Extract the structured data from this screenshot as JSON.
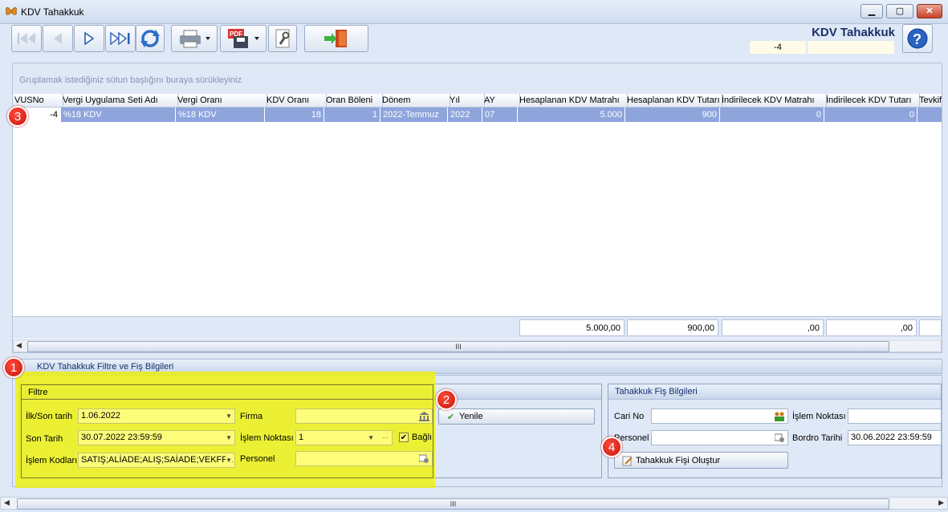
{
  "window": {
    "title": "KDV Tahakkuk",
    "min": "▁",
    "max": "▢",
    "close": "✕"
  },
  "header": {
    "title": "KDV Tahakkuk",
    "value": "-4",
    "value2": ""
  },
  "grid": {
    "group_prompt": "Gruplamak istediğiniz sütun başlığını buraya sürükleyiniz",
    "columns": [
      "VUSNo",
      "Vergi Uygulama Seti Adı",
      "Vergi Oranı",
      "KDV Oranı",
      "Oran Böleni",
      "Dönem",
      "Yıl",
      "AY",
      "Hesaplanan KDV Matrahı",
      "Hesaplanan KDV Tutarı",
      "İndirilecek KDV Matrahı",
      "İndirilecek KDV Tutarı",
      "Tevkif"
    ],
    "row": [
      "-4",
      "%18 KDV",
      "%18 KDV",
      "18",
      "1",
      "2022-Temmuz",
      "2022",
      "07",
      "5.000",
      "900",
      "0",
      "0",
      ""
    ],
    "totals": [
      "5.000,00",
      "900,00",
      ",00",
      ",00"
    ],
    "scroll_thumb": "III"
  },
  "section": {
    "title": "KDV Tahakkuk Filtre ve Fiş Bilgileri"
  },
  "filter": {
    "title": "Filtre",
    "ilk_son_label": "İlk/Son tarih",
    "ilk_son_value": "1.06.2022",
    "son_tarih_label": "Son Tarih",
    "son_tarih_value": "30.07.2022 23:59:59",
    "islem_kodlari_label": "İşlem Kodları",
    "islem_kodlari_value": "SATIŞ;ALİADE;ALIŞ;SAİADE;VEKFFA",
    "firma_label": "Firma",
    "firma_value": "",
    "islem_noktasi_label": "İşlem Noktası",
    "islem_noktasi_value": "1",
    "bagli_label": "Bağlı",
    "personel_label": "Personel",
    "personel_value": ""
  },
  "refresh_button": "Yenile",
  "fis": {
    "title": "Tahakkuk Fiş Bilgileri",
    "cari_no_label": "Cari No",
    "cari_no_value": "",
    "personel_label": "Personel",
    "personel_value": "",
    "islem_noktasi_label": "İşlem Noktası",
    "islem_noktasi_value": "",
    "bordro_tarihi_label": "Bordro Tarihi",
    "bordro_tarihi_value": "30.06.2022 23:59:59",
    "create_button": "Tahakkuk Fişi Oluştur"
  },
  "badges": [
    "1",
    "2",
    "3",
    "4"
  ],
  "colors": {
    "highlight": "#eef20a",
    "selected_row": "#8ea5dc",
    "badge": "#d8160e",
    "title": "#1b2f6a"
  }
}
